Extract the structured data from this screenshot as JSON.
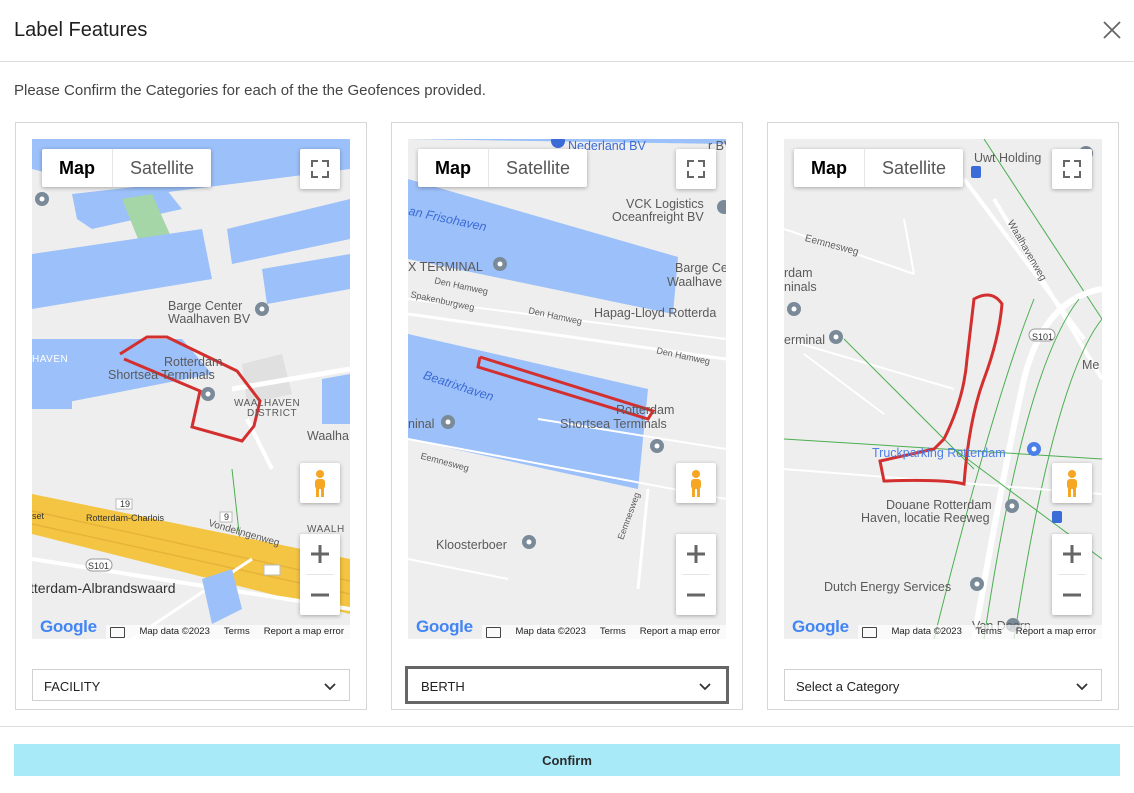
{
  "dialog": {
    "title": "Label Features",
    "instruction": "Please Confirm the Categories for each of the the Geofences provided.",
    "confirm_label": "Confirm"
  },
  "map_common": {
    "map_label": "Map",
    "satellite_label": "Satellite",
    "google_logo": "Google",
    "map_data": "Map data ©2023",
    "terms": "Terms",
    "report": "Report a map error"
  },
  "colors": {
    "water": "#9cc0f9",
    "land": "#eeeeee",
    "geofence": "#d32f2f",
    "highway": "#f4c542",
    "confirm_bg": "#a8eaf8"
  },
  "cards": [
    {
      "category": "FACILITY",
      "labels": [
        "Barge Center",
        "Waalhaven BV",
        "Rotterdam",
        "Shortsea Terminals",
        "WAALHAVEN",
        "DISTRICT",
        "HAVEN",
        "Waalha",
        "WAALH",
        "Rotterdam-Charlois",
        "Vondelingenweg",
        "tterdam-Albrandswaard",
        "19",
        "9",
        "S101",
        "set"
      ]
    },
    {
      "category": "BERTH",
      "labels": [
        "Nederland BV",
        "an Frisohaven",
        "VCK Logistics",
        "Oceanfreight BV",
        "X TERMINAL",
        "Barge Ce",
        "Waalhave",
        "Den Hamweg",
        "Spakenburgweg",
        "Den Hamweg",
        "Hapag-Lloyd Rotterda",
        "Den Hamweg",
        "Beatrixhaven",
        "Rotterdam",
        "Shortsea Terminals",
        "ninal",
        "Eemnesweg",
        "Eemnesweg",
        "Kloosterboer",
        "r BV"
      ]
    },
    {
      "category": "Select a Category",
      "labels": [
        "Uwt Holding",
        "Eemnesweg",
        "rdam",
        "ninals",
        "Waalhavenweg",
        "S101",
        "Me",
        "erminal",
        "Truckparking Rotterdam",
        "Douane Rotterdam",
        "Haven, locatie Reeweg",
        "Dutch Energy Services",
        "Van Doorn"
      ]
    }
  ]
}
